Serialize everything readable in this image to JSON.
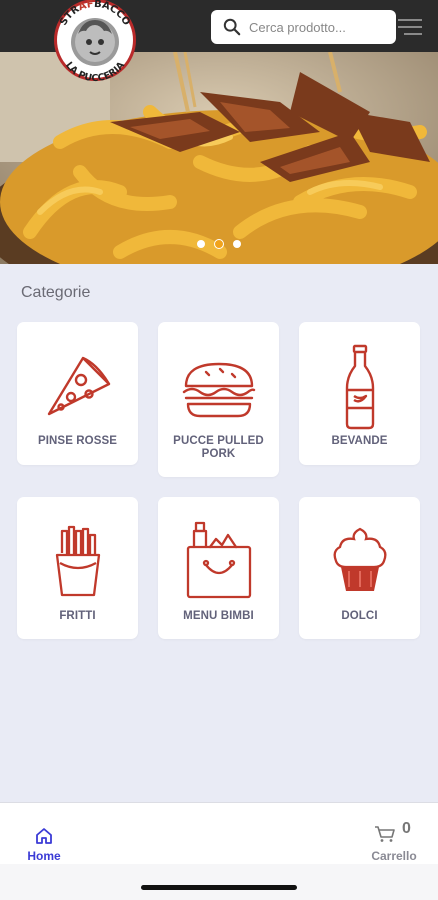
{
  "brand": {
    "logo_text_top": "STRAFBACCO",
    "logo_text_bottom": "LA PUCCERIA"
  },
  "search": {
    "placeholder": "Cerca prodotto..."
  },
  "carousel": {
    "slide_count": 3,
    "active_index": 1
  },
  "categories_title": "Categorie",
  "categories": [
    {
      "label": "PINSE ROSSE",
      "icon": "pizza-slice-icon"
    },
    {
      "label": "PUCCE PULLED PORK",
      "icon": "burger-icon"
    },
    {
      "label": "BEVANDE",
      "icon": "bottle-icon"
    },
    {
      "label": "FRITTI",
      "icon": "fries-icon"
    },
    {
      "label": "MENU BIMBI",
      "icon": "kids-bag-icon"
    },
    {
      "label": "DOLCI",
      "icon": "cupcake-icon"
    }
  ],
  "nav": {
    "home_label": "Home",
    "cart_label": "Carrello",
    "cart_count": "0"
  },
  "colors": {
    "accent": "#3b3bd6",
    "icon_red": "#c0392b",
    "background": "#e9ebf5",
    "topbar": "#2b2b2b",
    "carousel_active": "#f1a31b"
  }
}
